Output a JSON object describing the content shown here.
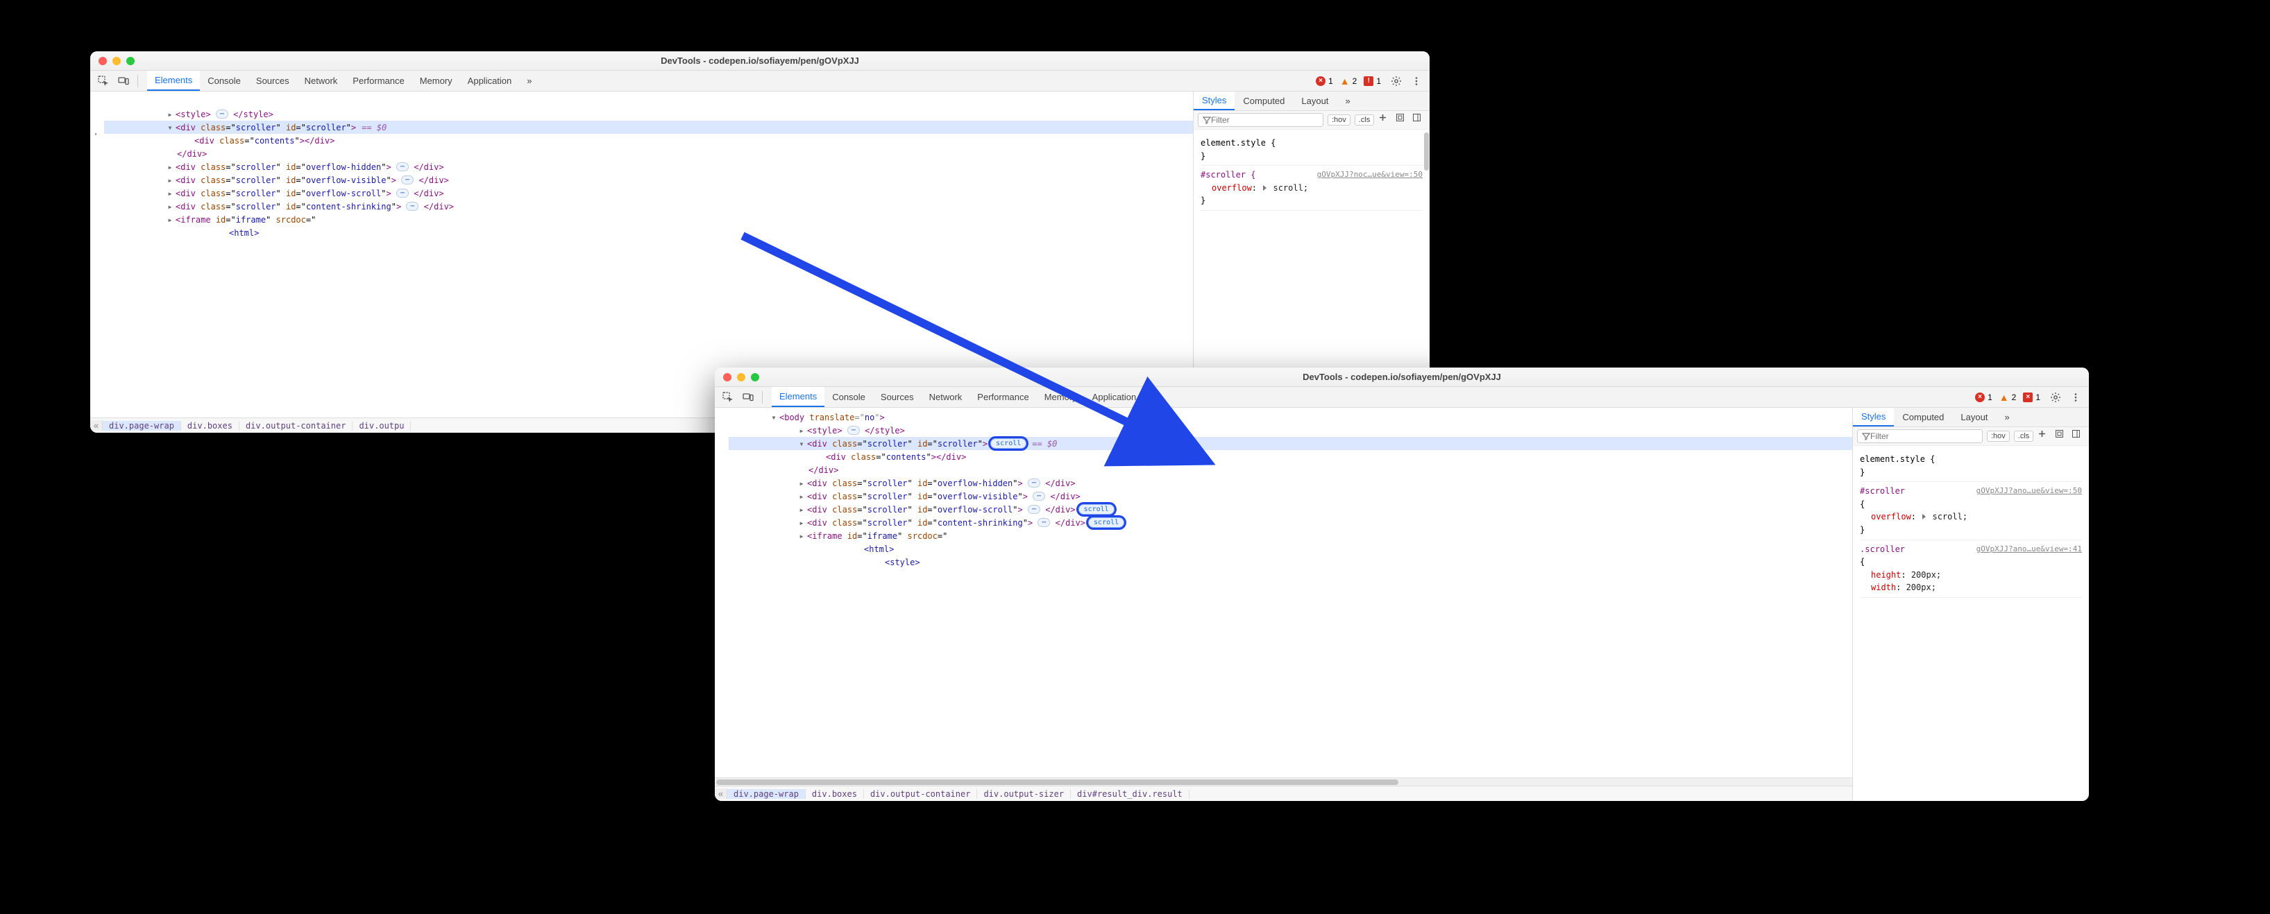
{
  "window_title": "DevTools - codepen.io/sofiayem/pen/gOVpXJJ",
  "main_tabs": [
    "Elements",
    "Console",
    "Sources",
    "Network",
    "Performance",
    "Memory",
    "Application"
  ],
  "main_tabs_active": 0,
  "status": {
    "errors": "1",
    "warnings": "2",
    "issues": "1"
  },
  "side_tabs": [
    "Styles",
    "Computed",
    "Layout"
  ],
  "side_tabs_active": 0,
  "filter_placeholder": "Filter",
  "pill_hov": ":hov",
  "pill_cls": ".cls",
  "styles_a": {
    "element_style_open": "element.style {",
    "element_style_close": "}",
    "rule1_sel": "#scroller {",
    "rule1_src": "gOVpXJJ?noc…ue&view=:50",
    "rule1_prop": "overflow",
    "rule1_val": "scroll;"
  },
  "styles_b": {
    "element_style_open": "element.style {",
    "element_style_close": "}",
    "rule1_sel": "#scroller",
    "rule1_src": "gOVpXJJ?ano…ue&view=:50",
    "rule1_brace_open": "{",
    "rule1_prop": "overflow",
    "rule1_val": "scroll;",
    "rule1_brace_close": "}",
    "rule2_sel": ".scroller",
    "rule2_src": "gOVpXJJ?ano…ue&view=:41",
    "rule2_brace_open": "{",
    "rule2_p1": "height",
    "rule2_v1": "200px;",
    "rule2_p2": "width",
    "rule2_v2": "200px;"
  },
  "tree_common": {
    "body_row": "<body translate=\"no\">",
    "style_open": "<style>",
    "style_close": "</style>",
    "contents": "<div class=\"contents\"></div>",
    "close_div": "</div>",
    "iframe_open": "<iframe id=\"iframe\" srcdoc=\"",
    "html_inner": "<html>",
    "style_inner": "<style>",
    "eq0": "== $0"
  },
  "elements": {
    "scroller_main_open": {
      "tag": "div",
      "class": "scroller",
      "id": "scroller",
      "suffix": ">"
    },
    "overflow_hidden": {
      "tag": "div",
      "class": "scroller",
      "id": "overflow-hidden",
      "suffix": ">"
    },
    "overflow_visible": {
      "tag": "div",
      "class": "scroller",
      "id": "overflow-visible",
      "suffix": ">"
    },
    "overflow_scroll": {
      "tag": "div",
      "class": "scroller",
      "id": "overflow-scroll",
      "suffix": ">"
    },
    "content_shrinking": {
      "tag": "div",
      "class": "scroller",
      "id": "content-shrinking",
      "suffix": ">"
    }
  },
  "badge_scroll": "scroll",
  "breadcrumb_a": [
    "div.page-wrap",
    "div.boxes",
    "div.output-container",
    "div.outpu"
  ],
  "breadcrumb_b": [
    "div.page-wrap",
    "div.boxes",
    "div.output-container",
    "div.output-sizer",
    "div#result_div.result"
  ]
}
